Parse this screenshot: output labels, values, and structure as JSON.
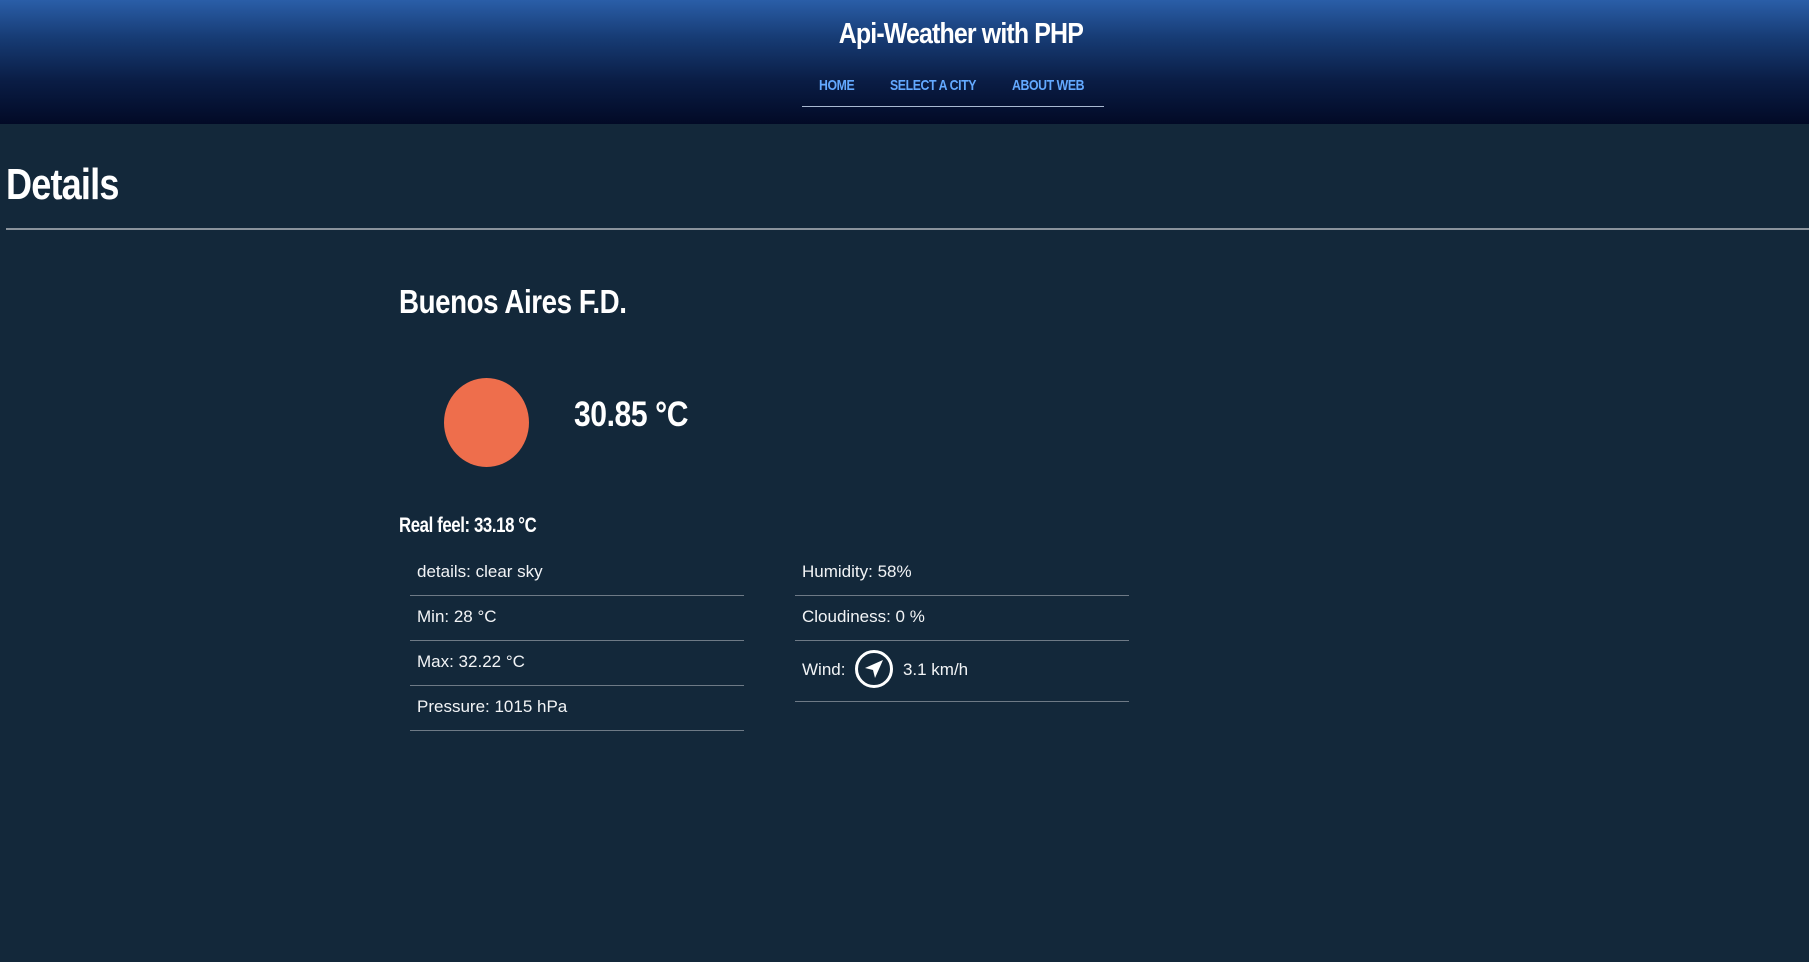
{
  "header": {
    "title": "Api-Weather with PHP",
    "nav": [
      "HOME",
      "SELECT A CITY",
      "ABOUT WEB"
    ]
  },
  "page": {
    "title": "Details"
  },
  "weather": {
    "city": "Buenos Aires F.D.",
    "icon": "sun-icon",
    "icon_color": "#ee6e4c",
    "temperature": "30.85 °C",
    "real_feel": "Real feel: 33.18 °C",
    "left_details": [
      "details: clear sky",
      "Min: 28 °C",
      "Max: 32.22 °C",
      "Pressure: 1015 hPa"
    ],
    "humidity": "Humidity: 58%",
    "cloudiness": "Cloudiness: 0 %",
    "wind_label": "Wind:",
    "wind_icon": "wind-direction-icon",
    "wind_speed": "3.1 km/h"
  },
  "colors": {
    "background": "#13283a",
    "nav_link": "#63a9ff"
  }
}
